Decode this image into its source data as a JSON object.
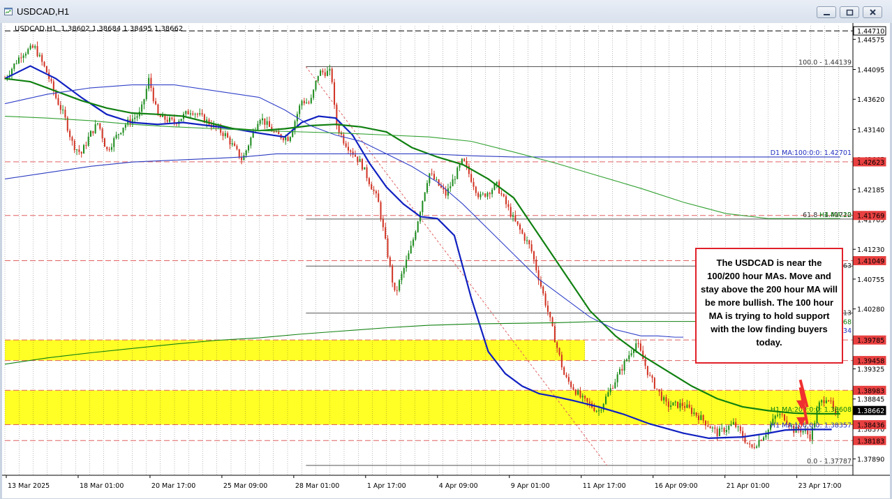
{
  "window": {
    "title": "USDCAD,H1"
  },
  "chart_data": {
    "type": "line",
    "symbol_header": "USDCAD,H1  1.38602 1.38684 1.38495 1.38662",
    "note": "The USDCAD is near the 100/200 hour MAs.  Move and stay above the 200 hour MA will be more bullish.  The 100 hour MA is trying to hold support with the low finding buyers today.",
    "ylim": [
      1.3763,
      1.4479
    ],
    "y_ticks": [
      "1.44575",
      "1.44095",
      "1.43620",
      "1.43140",
      "1.42665",
      "1.42185",
      "1.41705",
      "1.41230",
      "1.40755",
      "1.40280",
      "1.39800",
      "1.39325",
      "1.38845",
      "1.38370",
      "1.37890"
    ],
    "x_ticks": [
      "13 Mar 2025",
      "18 Mar 01:00",
      "20 Mar 17:00",
      "25 Mar 09:00",
      "28 Mar 01:00",
      "1 Apr 17:00",
      "4 Apr 09:00",
      "9 Apr 01:00",
      "11 Apr 17:00",
      "16 Apr 09:00",
      "21 Apr 01:00",
      "23 Apr 17:00"
    ],
    "price_tags": [
      {
        "label": "1.44710",
        "value": 1.4471,
        "style": "black"
      },
      {
        "label": "1.42623",
        "value": 1.42623,
        "style": "red"
      },
      {
        "label": "1.41769",
        "value": 1.41769,
        "style": "red"
      },
      {
        "label": "1.41049",
        "value": 1.41049,
        "style": "red"
      },
      {
        "label": "1.39785",
        "value": 1.39785,
        "style": "red"
      },
      {
        "label": "1.39458",
        "value": 1.39458,
        "style": "red"
      },
      {
        "label": "1.38983",
        "value": 1.38983,
        "style": "red"
      },
      {
        "label": "1.38662",
        "value": 1.38662,
        "style": "current"
      },
      {
        "label": "1.38436",
        "value": 1.38436,
        "style": "red"
      },
      {
        "label": "1.38183",
        "value": 1.38183,
        "style": "red"
      }
    ],
    "horizontal_lines": [
      {
        "value": 1.4471,
        "color": "#000000",
        "dash": true
      },
      {
        "value": 1.42623,
        "color": "#e06060",
        "dash": true
      },
      {
        "value": 1.41769,
        "color": "#e06060",
        "dash": true
      },
      {
        "value": 1.41049,
        "color": "#e06060",
        "dash": true
      },
      {
        "value": 1.39785,
        "color": "#e06060",
        "dash": true
      },
      {
        "value": 1.39458,
        "color": "#e06060",
        "dash": true
      },
      {
        "value": 1.38983,
        "color": "#e06060",
        "dash": true
      },
      {
        "value": 1.38436,
        "color": "#e06060",
        "dash": true
      },
      {
        "value": 1.38183,
        "color": "#e06060",
        "dash": true
      }
    ],
    "zones": [
      {
        "from": 1.39458,
        "to": 1.39785,
        "color": "#ffff00",
        "x_end": 0.684
      },
      {
        "from": 1.38436,
        "to": 1.38983,
        "color": "#ffff00",
        "x_end": 1.0
      }
    ],
    "fibonacci": {
      "x_start": 0.355,
      "levels": [
        {
          "label": "100.0 - 1.44139",
          "value": 1.44139
        },
        {
          "label": "61.8 - 1.41712",
          "value": 1.41712
        },
        {
          "label": "",
          "value": 1.40963
        },
        {
          "label": "",
          "value": 1.40213
        },
        {
          "label": "0.0 - 1.37787",
          "value": 1.37787
        }
      ]
    },
    "ma_labels": [
      {
        "label": "D1 MA:100:0:0: 1.42701",
        "value": 1.42701,
        "color": "#2030c0"
      },
      {
        "label": "H4 MA:20",
        "value": 1.41712,
        "color": "#108010"
      },
      {
        "label": "H1 MA:200:0:0: 1.38608",
        "value": 1.38608,
        "color": "#108010"
      },
      {
        "label": "H1 MA:100:0:0: 1.38357",
        "value": 1.38357,
        "color": "#2030c0"
      }
    ],
    "edge_labels": [
      {
        "label": "963",
        "value": 1.40963
      },
      {
        "label": "213",
        "value": 1.40213
      },
      {
        "label": "068",
        "value": 1.40068,
        "color": "#108010"
      },
      {
        "label": "934",
        "value": 1.39934,
        "color": "#2030c0"
      }
    ],
    "series": [
      {
        "color": "#20a020",
        "x": [
          0.0,
          0.02,
          0.035,
          0.05,
          0.06,
          0.07,
          0.08,
          0.09,
          0.1,
          0.11,
          0.12,
          0.14,
          0.16,
          0.17,
          0.18,
          0.2,
          0.22,
          0.24,
          0.26,
          0.28,
          0.3,
          0.32,
          0.335,
          0.35,
          0.36,
          0.37,
          0.385,
          0.39,
          0.4,
          0.42,
          0.44,
          0.46,
          0.48,
          0.5,
          0.52,
          0.54,
          0.56,
          0.58,
          0.6,
          0.62,
          0.64,
          0.66,
          0.68,
          0.7,
          0.72,
          0.74,
          0.745,
          0.76,
          0.78,
          0.8,
          0.82,
          0.84,
          0.86,
          0.88,
          0.9,
          0.91,
          0.92,
          0.93,
          0.94,
          0.95,
          0.96,
          0.97,
          0.98,
          0.985
        ],
        "y": [
          1.4395,
          1.4435,
          1.4445,
          1.4403,
          1.4365,
          1.4335,
          1.429,
          1.4275,
          1.4305,
          1.4325,
          1.428,
          1.432,
          1.434,
          1.4395,
          1.4335,
          1.4325,
          1.4345,
          1.4325,
          1.4305,
          1.4265,
          1.4335,
          1.4305,
          1.43,
          1.436,
          1.4355,
          1.4405,
          1.4405,
          1.4325,
          1.4295,
          1.426,
          1.42,
          1.405,
          1.413,
          1.4245,
          1.421,
          1.4265,
          1.4205,
          1.4225,
          1.417,
          1.4125,
          1.4025,
          1.392,
          1.3885,
          1.3865,
          1.3915,
          1.3965,
          1.3975,
          1.392,
          1.3875,
          1.3875,
          1.3855,
          1.383,
          1.3845,
          1.3805,
          1.3835,
          1.386,
          1.3855,
          1.3835,
          1.3835,
          1.3825,
          1.3875,
          1.389,
          1.3855,
          1.3866
        ]
      },
      {
        "color": "#1020c0",
        "x": [
          0.0,
          0.03,
          0.06,
          0.09,
          0.12,
          0.15,
          0.18,
          0.21,
          0.24,
          0.27,
          0.3,
          0.33,
          0.35,
          0.37,
          0.39,
          0.41,
          0.43,
          0.45,
          0.47,
          0.49,
          0.51,
          0.53,
          0.55,
          0.57,
          0.59,
          0.61,
          0.63,
          0.65,
          0.67,
          0.7,
          0.73,
          0.76,
          0.8,
          0.83,
          0.87,
          0.9,
          0.92,
          0.94,
          0.96,
          0.975
        ],
        "y": [
          1.4395,
          1.4415,
          1.4395,
          1.4365,
          1.4338,
          1.4325,
          1.4322,
          1.4325,
          1.432,
          1.4315,
          1.4308,
          1.4302,
          1.4325,
          1.4335,
          1.4332,
          1.4305,
          1.426,
          1.4222,
          1.4195,
          1.4175,
          1.4172,
          1.4145,
          1.4045,
          1.396,
          1.3925,
          1.3905,
          1.3893,
          1.3888,
          1.3882,
          1.3872,
          1.386,
          1.3845,
          1.383,
          1.3822,
          1.3824,
          1.383,
          1.3835,
          1.3836,
          1.3836,
          1.3836
        ]
      },
      {
        "color": "#108010",
        "x": [
          0.0,
          0.03,
          0.06,
          0.09,
          0.12,
          0.15,
          0.18,
          0.21,
          0.24,
          0.27,
          0.3,
          0.33,
          0.36,
          0.39,
          0.42,
          0.45,
          0.48,
          0.51,
          0.54,
          0.57,
          0.6,
          0.63,
          0.66,
          0.69,
          0.72,
          0.75,
          0.78,
          0.81,
          0.84,
          0.87,
          0.9,
          0.93,
          0.96,
          0.98,
          0.985
        ],
        "y": [
          1.4395,
          1.439,
          1.4375,
          1.436,
          1.4348,
          1.434,
          1.4338,
          1.4335,
          1.4325,
          1.4315,
          1.4312,
          1.4315,
          1.432,
          1.4322,
          1.4318,
          1.431,
          1.4285,
          1.427,
          1.4258,
          1.4235,
          1.4205,
          1.4145,
          1.4085,
          1.4025,
          1.3985,
          1.3955,
          1.393,
          1.3905,
          1.3885,
          1.3872,
          1.3866,
          1.3862,
          1.3861,
          1.3861,
          1.3861
        ]
      },
      {
        "color": "#3040c8",
        "x": [
          0.0,
          0.05,
          0.1,
          0.15,
          0.2,
          0.25,
          0.3,
          0.33,
          0.36,
          0.39,
          0.42,
          0.45,
          0.48,
          0.51,
          0.54,
          0.57,
          0.6,
          0.63,
          0.66,
          0.69,
          0.72,
          0.75,
          0.77,
          0.79,
          0.8
        ],
        "y": [
          1.4355,
          1.437,
          1.438,
          1.4385,
          1.4385,
          1.4375,
          1.4365,
          1.4345,
          1.432,
          1.4305,
          1.4295,
          1.4275,
          1.4255,
          1.423,
          1.4195,
          1.4155,
          1.4115,
          1.4075,
          1.4045,
          1.4015,
          1.3995,
          1.3985,
          1.3985,
          1.3983,
          1.3983
        ]
      },
      {
        "color": "#2a3ac0",
        "x": [
          0.0,
          0.05,
          0.1,
          0.15,
          0.2,
          0.25,
          0.28,
          0.32,
          0.36,
          0.4,
          0.45,
          0.5,
          0.55,
          0.6,
          0.65,
          0.7,
          0.75,
          0.8,
          0.85,
          0.9,
          0.95,
          0.985
        ],
        "y": [
          1.4235,
          1.4245,
          1.4255,
          1.4262,
          1.4265,
          1.4268,
          1.427,
          1.4275,
          1.4275,
          1.4275,
          1.4275,
          1.4275,
          1.4272,
          1.427,
          1.427,
          1.427,
          1.427,
          1.427,
          1.427,
          1.427,
          1.427,
          1.427
        ]
      },
      {
        "color": "#30a030",
        "x": [
          0.0,
          0.05,
          0.1,
          0.15,
          0.2,
          0.25,
          0.3,
          0.35,
          0.4,
          0.45,
          0.5,
          0.55,
          0.6,
          0.65,
          0.7,
          0.75,
          0.8,
          0.85,
          0.9,
          0.95,
          0.985
        ],
        "y": [
          1.4335,
          1.4332,
          1.4328,
          1.4322,
          1.4318,
          1.4315,
          1.4312,
          1.431,
          1.4308,
          1.4305,
          1.4302,
          1.4295,
          1.4278,
          1.426,
          1.424,
          1.422,
          1.4198,
          1.418,
          1.4172,
          1.4172,
          1.4172
        ]
      },
      {
        "color": "#108010",
        "x": [
          0.0,
          0.05,
          0.1,
          0.15,
          0.2,
          0.25,
          0.3,
          0.35,
          0.4,
          0.45,
          0.5,
          0.55,
          0.6,
          0.65,
          0.7,
          0.75,
          0.8,
          0.85,
          0.9,
          0.95,
          0.985
        ],
        "y": [
          1.394,
          1.395,
          1.3958,
          1.3965,
          1.3972,
          1.3978,
          1.3982,
          1.3988,
          1.3993,
          1.3998,
          1.4002,
          1.4004,
          1.4005,
          1.4006,
          1.4008,
          1.4008,
          1.4008,
          1.4008,
          1.4008,
          1.4008,
          1.4008
        ]
      }
    ],
    "callout_arrows": [
      {
        "from_x": 0.905,
        "from_y": 1.3915,
        "to_x": 0.775,
        "to_y": 1.3867
      },
      {
        "from_x": 0.905,
        "from_y": 1.3903,
        "to_x": 0.775,
        "to_y": 1.384
      }
    ]
  }
}
